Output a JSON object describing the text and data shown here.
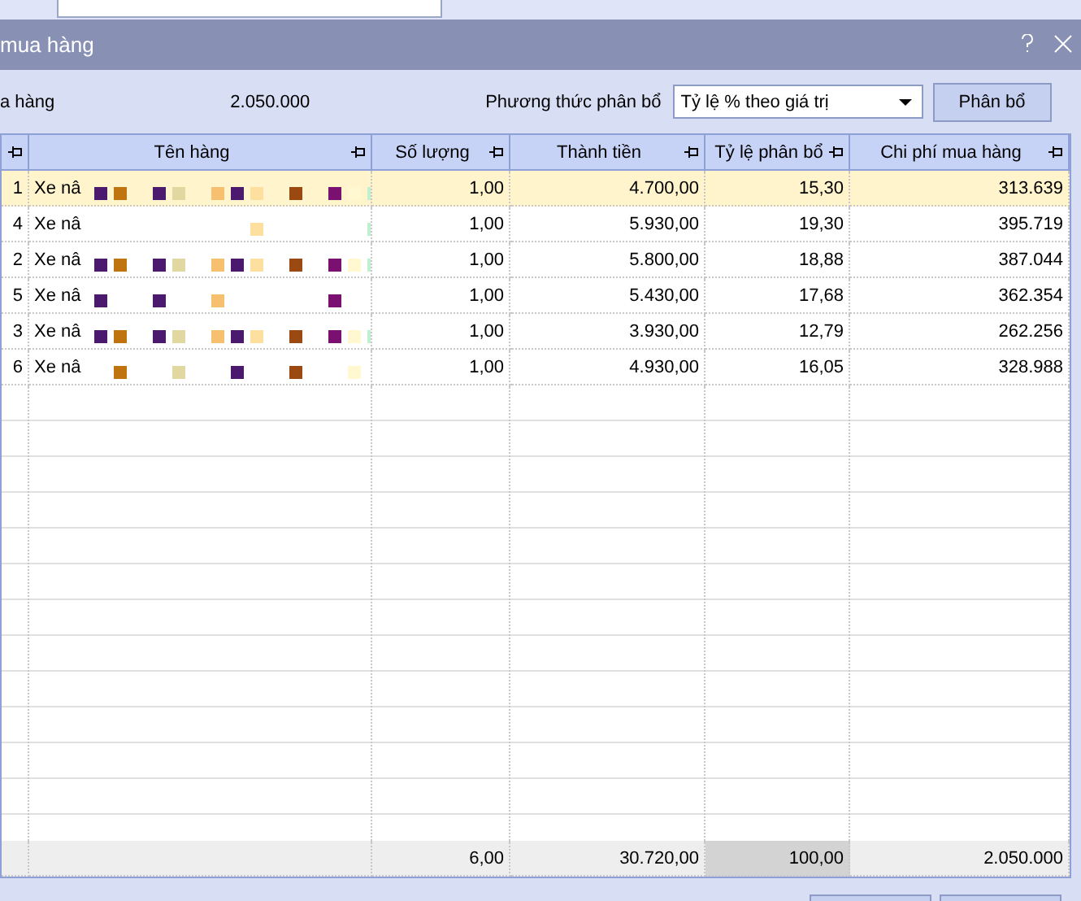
{
  "window": {
    "title": "mua hàng"
  },
  "summary": {
    "label": "a hàng",
    "value": "2.050.000"
  },
  "method": {
    "label": "Phương thức phân bổ",
    "value": "Tỷ lệ % theo giá trị"
  },
  "allocate_button": "Phân bổ",
  "table": {
    "columns": [
      "Tên hàng",
      "Số lượng",
      "Thành tiền",
      "Tỷ lệ phân bổ",
      "Chi phí mua hàng"
    ],
    "rows": [
      {
        "selected": true,
        "cells": [
          "1",
          "Xe nâ",
          "1,00",
          "4.700,00",
          "15,30",
          "313.639"
        ]
      },
      {
        "selected": false,
        "cells": [
          "4",
          "Xe nâ",
          "1,00",
          "5.930,00",
          "19,30",
          "395.719"
        ]
      },
      {
        "selected": false,
        "cells": [
          "2",
          "Xe nâ",
          "1,00",
          "5.800,00",
          "18,88",
          "387.044"
        ]
      },
      {
        "selected": false,
        "cells": [
          "5",
          "Xe nâ",
          "1,00",
          "5.430,00",
          "17,68",
          "362.354"
        ]
      },
      {
        "selected": false,
        "cells": [
          "3",
          "Xe nâ",
          "1,00",
          "3.930,00",
          "12,79",
          "262.256"
        ]
      },
      {
        "selected": false,
        "cells": [
          "6",
          "Xe nâ",
          "1,00",
          "4.930,00",
          "16,05",
          "328.988"
        ]
      }
    ],
    "totals": [
      "6,00",
      "30.720,00",
      "100,00",
      "2.050.000"
    ]
  }
}
